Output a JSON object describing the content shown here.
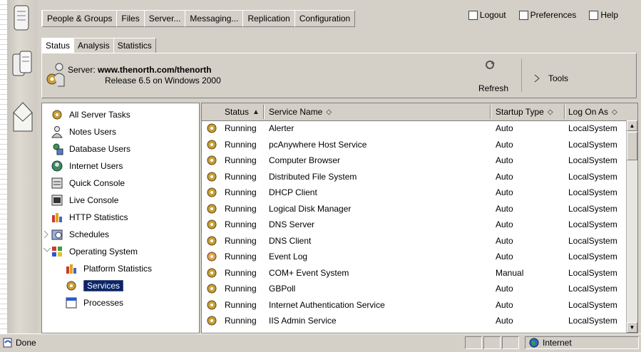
{
  "tabs": [
    "People & Groups",
    "Files",
    "Server...",
    "Messaging...",
    "Replication",
    "Configuration"
  ],
  "top_links": {
    "logout": "Logout",
    "preferences": "Preferences",
    "help": "Help"
  },
  "subtabs": [
    "Status",
    "Analysis",
    "Statistics"
  ],
  "server": {
    "label": "Server:",
    "name": "www.thenorth.com/thenorth",
    "release": "Release 6.5 on Windows 2000"
  },
  "toolbar": {
    "refresh": "Refresh",
    "tools": "Tools"
  },
  "tree": [
    {
      "label": "All Server Tasks",
      "icon": "gear-icon"
    },
    {
      "label": "Notes Users",
      "icon": "user-icon"
    },
    {
      "label": "Database Users",
      "icon": "database-user-icon"
    },
    {
      "label": "Internet Users",
      "icon": "internet-user-icon"
    },
    {
      "label": "Quick Console",
      "icon": "console-icon"
    },
    {
      "label": "Live Console",
      "icon": "console-icon"
    },
    {
      "label": "HTTP Statistics",
      "icon": "bar-chart-icon"
    },
    {
      "label": "Schedules",
      "icon": "calendar-icon"
    },
    {
      "label": "Operating System",
      "icon": "os-icon"
    },
    {
      "label": "Platform Statistics",
      "icon": "bar-chart-icon"
    },
    {
      "label": "Services",
      "icon": "gear-icon"
    },
    {
      "label": "Processes",
      "icon": "window-icon"
    }
  ],
  "columns": {
    "status": "Status",
    "service_name": "Service Name",
    "startup_type": "Startup Type",
    "log_on_as": "Log On As"
  },
  "rows": [
    {
      "status": "Running",
      "name": "Alerter",
      "startup": "Auto",
      "logon": "LocalSystem"
    },
    {
      "status": "Running",
      "name": "pcAnywhere Host Service",
      "startup": "Auto",
      "logon": "LocalSystem"
    },
    {
      "status": "Running",
      "name": "Computer Browser",
      "startup": "Auto",
      "logon": "LocalSystem"
    },
    {
      "status": "Running",
      "name": "Distributed File System",
      "startup": "Auto",
      "logon": "LocalSystem"
    },
    {
      "status": "Running",
      "name": "DHCP Client",
      "startup": "Auto",
      "logon": "LocalSystem"
    },
    {
      "status": "Running",
      "name": "Logical Disk Manager",
      "startup": "Auto",
      "logon": "LocalSystem"
    },
    {
      "status": "Running",
      "name": "DNS Server",
      "startup": "Auto",
      "logon": "LocalSystem"
    },
    {
      "status": "Running",
      "name": "DNS Client",
      "startup": "Auto",
      "logon": "LocalSystem"
    },
    {
      "status": "Running",
      "name": "Event Log",
      "startup": "Auto",
      "logon": "LocalSystem"
    },
    {
      "status": "Running",
      "name": "COM+ Event System",
      "startup": "Manual",
      "logon": "LocalSystem"
    },
    {
      "status": "Running",
      "name": "GBPoll",
      "startup": "Auto",
      "logon": "LocalSystem"
    },
    {
      "status": "Running",
      "name": "Internet Authentication Service",
      "startup": "Auto",
      "logon": "LocalSystem"
    },
    {
      "status": "Running",
      "name": "IIS Admin Service",
      "startup": "Auto",
      "logon": "LocalSystem"
    }
  ],
  "statusbar": {
    "text": "Done",
    "zone": "Internet"
  },
  "colors": {
    "selection": "#0a246a",
    "chrome": "#d4d0c8",
    "gear": "#c8a038"
  }
}
